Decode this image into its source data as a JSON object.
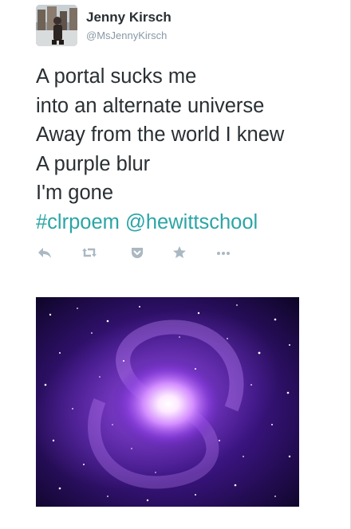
{
  "tweet": {
    "author": {
      "display_name": "Jenny Kirsch",
      "handle": "@MsJennyKirsch",
      "avatar_icon": "profile-photo"
    },
    "lines": [
      "A portal sucks me",
      "into an alternate universe",
      "Away from the world I knew",
      "A purple blur",
      "I'm gone"
    ],
    "hashtag": "#clrpoem",
    "mention": "@hewittschool",
    "link_color": "#2ba5a5",
    "actions": [
      "reply-icon",
      "retweet-icon",
      "pocket-icon",
      "favorite-icon",
      "more-icon"
    ],
    "media": {
      "icon": "purple-galaxy-image",
      "colors": [
        "#ffffff",
        "#c77dff",
        "#7a2fd0",
        "#2a0b5e",
        "#0a0420"
      ]
    }
  }
}
